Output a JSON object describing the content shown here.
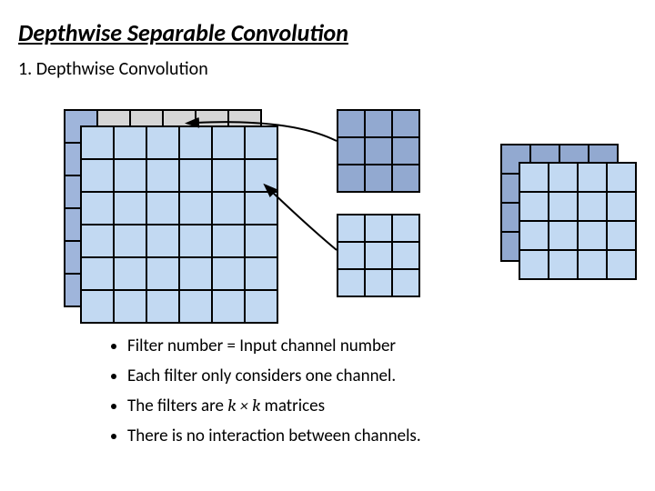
{
  "title": "Depthwise Separable Convolution",
  "subtitle": "1. Depthwise Convolution",
  "bullets": {
    "b1": "Filter number = Input channel number",
    "b2": "Each filter only considers one channel.",
    "b3_prefix": "The filters are ",
    "b3_math": "k × k",
    "b3_suffix": " matrices",
    "b4": "There is no interaction between channels."
  }
}
